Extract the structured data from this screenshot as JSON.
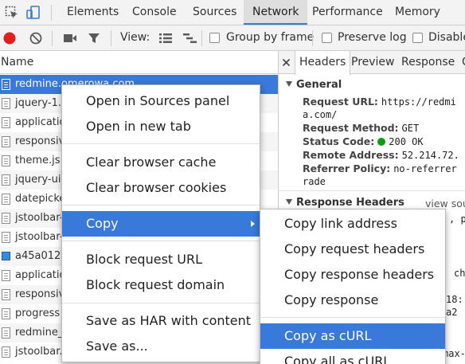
{
  "panel_tabs": [
    "Elements",
    "Console",
    "Sources",
    "Network",
    "Performance",
    "Memory"
  ],
  "toolbar": {
    "view_label": "View:",
    "group_by_frame": "Group by frame",
    "preserve_log": "Preserve log",
    "disable_cache": "Disable"
  },
  "requests": {
    "column_name": "Name",
    "items": [
      "redmine.omerowa.com",
      "jquery-1.",
      "application",
      "responsiv",
      "theme.js",
      "jquery-ui",
      "datepicke",
      "jstoolbar-",
      "jstoolbar-",
      "a45a012",
      "application",
      "responsiv",
      "progress",
      "redmine_",
      "jstoolbar."
    ]
  },
  "details": {
    "tabs": [
      "Headers",
      "Preview",
      "Response",
      "C"
    ],
    "general_title": "General",
    "request_url_key": "Request URL:",
    "request_url_value": "https://redmi",
    "request_url_cont": "a.com/",
    "request_method_key": "Request Method:",
    "request_method_value": "GET",
    "status_code_key": "Status Code:",
    "status_code_value": "200 OK",
    "remote_address_key": "Remote Address:",
    "remote_address_value": "52.214.72.",
    "referrer_policy_key": "Referrer Policy:",
    "referrer_policy_value": "no-referrer",
    "referrer_policy_cont": "rade",
    "response_headers_title": "Response Headers",
    "view_source": "view sou",
    "frag_comma_p": ", p",
    "frag_ch": "ch",
    "frag_18": "18:",
    "frag_a2": "a2",
    "frag_max": "max-"
  },
  "context_menu": {
    "items": [
      "Open in Sources panel",
      "Open in new tab",
      "Clear browser cache",
      "Clear browser cookies",
      "Copy",
      "Block request URL",
      "Block request domain",
      "Save as HAR with content",
      "Save as..."
    ]
  },
  "copy_submenu": {
    "items": [
      "Copy link address",
      "Copy request headers",
      "Copy response headers",
      "Copy response",
      "Copy as cURL",
      "Copy all as cURL"
    ]
  },
  "colors": {
    "accent": "#3879d9",
    "record": "#e31e1e",
    "status_ok": "#0a9d0a"
  },
  "icons": [
    "inspect-element-icon",
    "device-toolbar-icon",
    "record-icon",
    "clear-icon",
    "video-camera-icon",
    "filter-icon",
    "list-view-icon",
    "waterfall-view-icon",
    "close-icon",
    "document-icon",
    "image-icon",
    "submenu-arrow-icon"
  ]
}
